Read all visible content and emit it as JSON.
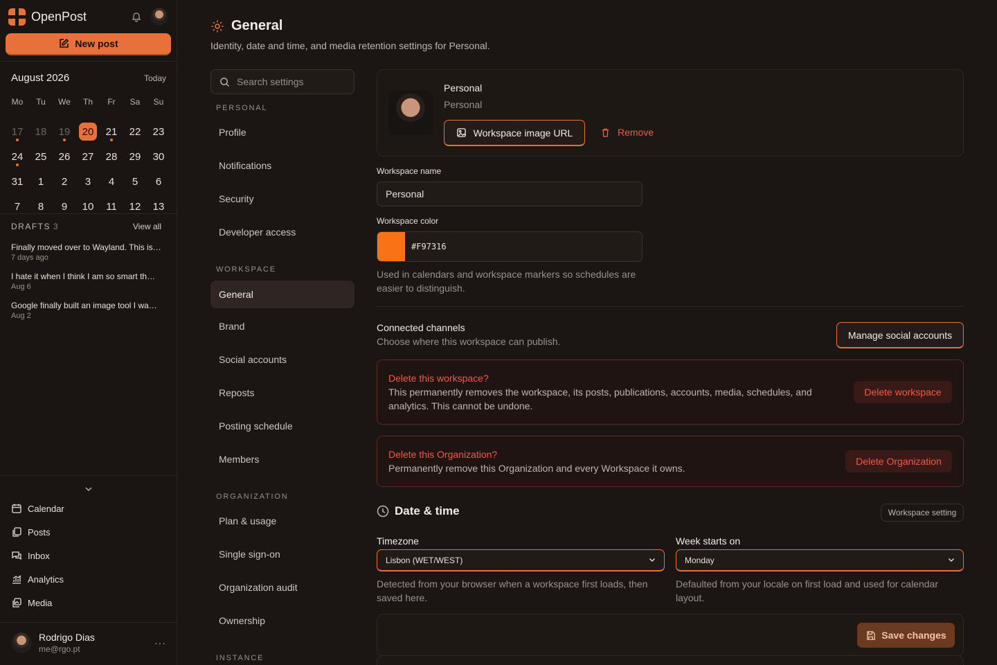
{
  "app": {
    "name": "OpenPost"
  },
  "sidebar": {
    "new_post": "New post",
    "calendar": {
      "month": "August 2026",
      "today_label": "Today",
      "weekdays": [
        "Mo",
        "Tu",
        "We",
        "Th",
        "Fr",
        "Sa",
        "Su"
      ],
      "weeks": [
        [
          "17",
          "18",
          "19",
          "20",
          "21",
          "22",
          "23"
        ],
        [
          "24",
          "25",
          "26",
          "27",
          "28",
          "29",
          "30"
        ],
        [
          "31",
          "1",
          "2",
          "3",
          "4",
          "5",
          "6"
        ],
        [
          "7",
          "8",
          "9",
          "10",
          "11",
          "12",
          "13"
        ]
      ],
      "today": "20"
    },
    "drafts": {
      "title": "DRAFTS",
      "count": "3",
      "view_all": "View all",
      "items": [
        {
          "title": "Finally moved over to Wayland. This is…",
          "date": "7 days ago"
        },
        {
          "title": "I hate it when I think I am so smart th…",
          "date": "Aug 6"
        },
        {
          "title": "Google finally built an image tool I wa…",
          "date": "Aug 2"
        }
      ]
    },
    "nav": [
      {
        "label": "Calendar",
        "icon": "calendar-icon"
      },
      {
        "label": "Posts",
        "icon": "posts-icon"
      },
      {
        "label": "Inbox",
        "icon": "inbox-icon"
      },
      {
        "label": "Analytics",
        "icon": "analytics-icon"
      },
      {
        "label": "Media",
        "icon": "media-icon"
      }
    ],
    "user": {
      "name": "Rodrigo Dias",
      "email": "me@rgo.pt",
      "menu": "···"
    }
  },
  "page": {
    "title": "General",
    "subtitle": "Identity, date and time, and media retention settings for Personal."
  },
  "settings_nav": {
    "search_placeholder": "Search settings",
    "sections": [
      {
        "label": "PERSONAL",
        "items": [
          "Profile",
          "Notifications",
          "Security",
          "Developer access"
        ]
      },
      {
        "label": "WORKSPACE",
        "items": [
          "General",
          "Brand",
          "Social accounts",
          "Reposts",
          "Posting schedule",
          "Members"
        ]
      },
      {
        "label": "ORGANIZATION",
        "items": [
          "Plan & usage",
          "Single sign-on",
          "Organization audit",
          "Ownership"
        ]
      },
      {
        "label": "INSTANCE",
        "items": []
      }
    ],
    "active": "General"
  },
  "workspace": {
    "name": "Personal",
    "subtitle": "Personal",
    "image_url_btn": "Workspace image URL",
    "remove_btn": "Remove",
    "name_label": "Workspace name",
    "name_value": "Personal",
    "color_label": "Workspace color",
    "color_value": "#F97316",
    "color_help": "Used in calendars and workspace markers so schedules are easier to distinguish."
  },
  "channels": {
    "title": "Connected channels",
    "subtitle": "Choose where this workspace can publish.",
    "manage_btn": "Manage social accounts"
  },
  "danger": {
    "workspace": {
      "title": "Delete this workspace?",
      "text": "This permanently removes the workspace, its posts, publications, accounts, media, schedules, and analytics. This cannot be undone.",
      "button": "Delete workspace"
    },
    "organization": {
      "title": "Delete this Organization?",
      "text": "Permanently remove this Organization and every Workspace it owns.",
      "button": "Delete Organization"
    }
  },
  "datetime": {
    "title": "Date & time",
    "badge": "Workspace setting",
    "timezone_label": "Timezone",
    "timezone_value": "Lisbon (WET/WEST)",
    "timezone_help": "Detected from your browser when a workspace first loads, then saved here.",
    "week_label": "Week starts on",
    "week_value": "Monday",
    "week_help": "Defaulted from your locale on first load and used for calendar layout."
  },
  "save_btn": "Save changes",
  "colors": {
    "accent": "#E8703A",
    "danger": "#EF5A4A",
    "workspace": "#F97316"
  }
}
